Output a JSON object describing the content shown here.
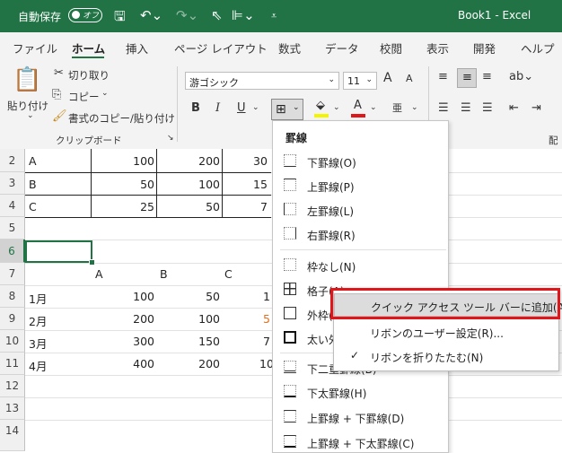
{
  "titlebar": {
    "autosave_label": "自動保存",
    "toggle_label": "オフ",
    "title": "Book1  -  Excel",
    "bg_color": "#217346"
  },
  "menu": {
    "items": [
      "ファイル",
      "ホーム",
      "挿入",
      "ページ レイアウト",
      "数式",
      "データ",
      "校閲",
      "表示",
      "開発",
      "ヘルプ"
    ],
    "active": "ホーム"
  },
  "ribbon": {
    "paste_label": "貼り付け",
    "cut_label": "切り取り",
    "copy_label": "コピー",
    "format_painter_label": "書式のコピー/貼り付け",
    "clipboard_group": "クリップボード",
    "font_name": "游ゴシック",
    "font_size": "11",
    "bold": "B",
    "italic": "I",
    "underline": "U",
    "font_color": "A",
    "phonetic": "亜",
    "grow_font": "A",
    "shrink_font": "A",
    "right_group_partial": "配"
  },
  "sheet": {
    "row_numbers": [
      "2",
      "3",
      "4",
      "5",
      "6",
      "7",
      "8",
      "9",
      "10",
      "11",
      "12",
      "13",
      "14"
    ],
    "selected_row": "6",
    "table1": [
      [
        "A",
        "100",
        "200",
        "30"
      ],
      [
        "B",
        "50",
        "100",
        "15"
      ],
      [
        "C",
        "25",
        "50",
        "7"
      ]
    ],
    "table2_headers": [
      "A",
      "B",
      "C"
    ],
    "table2": [
      [
        "1月",
        "100",
        "50",
        "1"
      ],
      [
        "2月",
        "200",
        "100",
        "5"
      ],
      [
        "3月",
        "300",
        "150",
        "7"
      ],
      [
        "4月",
        "400",
        "200",
        "10"
      ]
    ]
  },
  "border_menu": {
    "title": "罫線",
    "items": [
      {
        "label": "下罫線(O)",
        "icon": "bottom-border-icon"
      },
      {
        "label": "上罫線(P)",
        "icon": "top-border-icon"
      },
      {
        "label": "左罫線(L)",
        "icon": "left-border-icon"
      },
      {
        "label": "右罫線(R)",
        "icon": "right-border-icon"
      },
      {
        "label": "枠なし(N)",
        "icon": "no-border-icon"
      },
      {
        "label": "格子(A)",
        "icon": "all-borders-icon"
      },
      {
        "label": "外枠(S)",
        "icon": "outside-borders-icon"
      },
      {
        "label": "太い外枠(T)",
        "icon": "thick-box-border-icon"
      },
      {
        "label": "下二重罫線(B)",
        "icon": "double-bottom-border-icon"
      },
      {
        "label": "下太罫線(H)",
        "icon": "thick-bottom-border-icon"
      },
      {
        "label": "上罫線 + 下罫線(D)",
        "icon": "top-bottom-border-icon"
      },
      {
        "label": "上罫線 + 下太罫線(C)",
        "icon": "top-thick-bottom-border-icon"
      }
    ]
  },
  "context_menu": {
    "items": [
      {
        "label": "クイック アクセス ツール バーに追加(A)",
        "highlighted": true
      },
      {
        "label": "リボンのユーザー設定(R)...",
        "highlighted": false
      },
      {
        "label": "リボンを折りたたむ(N)",
        "checked": true
      }
    ],
    "check_mark": "✓",
    "highlight_color": "#e0161b"
  }
}
